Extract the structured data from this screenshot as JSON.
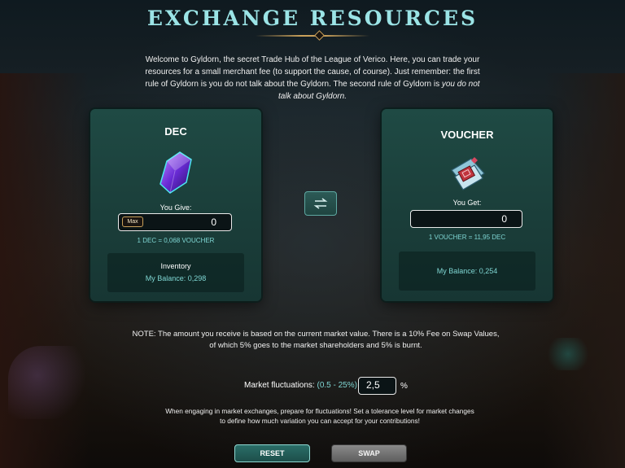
{
  "title": "EXCHANGE RESOURCES",
  "intro": {
    "text": "Welcome to Gyldorn, the secret Trade Hub of the League of Verico. Here, you can trade your resources for a small merchant fee (to support the cause, of course). Just remember: the first rule of Gyldorn is you do not talk about the Gyldorn. The second rule of Gyldorn is ",
    "emphasis": "you do not talk about Gyldorn."
  },
  "give_card": {
    "title": "DEC",
    "label": "You Give:",
    "max_label": "Max",
    "amount": "0",
    "rate": "1 DEC = 0,068 VOUCHER",
    "inventory_label": "Inventory",
    "balance": "My Balance: 0,298"
  },
  "get_card": {
    "title": "VOUCHER",
    "label": "You Get:",
    "amount": "0",
    "rate": "1 VOUCHER = 11,95 DEC",
    "balance": "My Balance: 0,254"
  },
  "note": "NOTE: The amount you receive is based on the current market value. There is a 10% Fee on Swap Values, of which 5% goes to the market shareholders and 5% is burnt.",
  "fluctuation": {
    "label": "Market fluctuations: ",
    "range": "(0.5 - 25%)",
    "value": "2,5",
    "unit": "%"
  },
  "hint": "When engaging in market exchanges, prepare for fluctuations! Set a tolerance level for market changes to define how much variation you can accept for your contributions!",
  "buttons": {
    "reset": "RESET",
    "swap": "SWAP"
  },
  "colors": {
    "accent": "#9be4e6",
    "panel": "#1f4a44",
    "teal_text": "#7fd6d3",
    "gold": "#c9a05a"
  },
  "icons": {
    "swap_toggle": "swap-arrows-icon",
    "dec": "dec-crystal-icon",
    "voucher": "voucher-ticket-icon"
  }
}
